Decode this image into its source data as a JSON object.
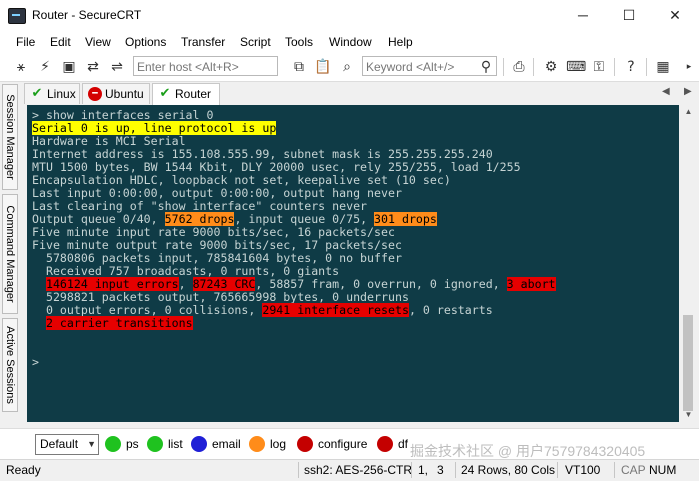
{
  "window": {
    "title": "Router - SecureCRT",
    "controls": [
      "─",
      "☐",
      "✕"
    ]
  },
  "menu": [
    "File",
    "Edit",
    "View",
    "Options",
    "Transfer",
    "Script",
    "Tools",
    "Window",
    "Help"
  ],
  "toolbar": {
    "host_placeholder": "Enter host <Alt+R>",
    "keyword_placeholder": "Keyword <Alt+/>"
  },
  "side_tabs": [
    "Session Manager",
    "Command Manager",
    "Active Sessions"
  ],
  "session_tabs": [
    {
      "label": "Linux",
      "icon": "check-icon",
      "color": "#1a9e1a"
    },
    {
      "label": "Ubuntu",
      "icon": "stop-icon",
      "color": "#d40000"
    },
    {
      "label": "Router",
      "icon": "check-icon",
      "color": "#1a9e1a"
    }
  ],
  "terminal": {
    "lines": [
      [
        {
          "t": "> show interfaces serial 0",
          "hl": ""
        }
      ],
      [
        {
          "t": "Serial 0 is up, line protocol is up",
          "hl": "yellow"
        }
      ],
      [
        {
          "t": "Hardware is MCI Serial",
          "hl": ""
        }
      ],
      [
        {
          "t": "Internet address is 155.108.555.99, subnet mask is 255.255.255.240",
          "hl": ""
        }
      ],
      [
        {
          "t": "MTU 1500 bytes, BW 1544 Kbit, DLY 20000 usec, rely 255/255, load 1/255",
          "hl": ""
        }
      ],
      [
        {
          "t": "Encapsulation HDLC, loopback not set, keepalive set (10 sec)",
          "hl": ""
        }
      ],
      [
        {
          "t": "Last input 0:00:00, output 0:00:00, output hang never",
          "hl": ""
        }
      ],
      [
        {
          "t": "Last clearing of \"show interface\" counters never",
          "hl": ""
        }
      ],
      [
        {
          "t": "Output queue 0/40, ",
          "hl": ""
        },
        {
          "t": "5762 drops",
          "hl": "orange"
        },
        {
          "t": ", input queue 0/75, ",
          "hl": ""
        },
        {
          "t": "301 drops",
          "hl": "orange"
        }
      ],
      [
        {
          "t": "Five minute input rate 9000 bits/sec, 16 packets/sec",
          "hl": ""
        }
      ],
      [
        {
          "t": "Five minute output rate 9000 bits/sec, 17 packets/sec",
          "hl": ""
        }
      ],
      [
        {
          "t": "  5780806 packets input, 785841604 bytes, 0 no buffer",
          "hl": ""
        }
      ],
      [
        {
          "t": "  Received 757 broadcasts, 0 runts, 0 giants",
          "hl": ""
        }
      ],
      [
        {
          "t": "  ",
          "hl": ""
        },
        {
          "t": "146124 input errors",
          "hl": "red"
        },
        {
          "t": ", ",
          "hl": ""
        },
        {
          "t": "87243 CRC",
          "hl": "red"
        },
        {
          "t": ", 58857 fram, 0 overrun, 0 ignored, ",
          "hl": ""
        },
        {
          "t": "3 abort",
          "hl": "red"
        }
      ],
      [
        {
          "t": "  5298821 packets output, 765665998 bytes, 0 underruns",
          "hl": ""
        }
      ],
      [
        {
          "t": "  0 output errors, 0 collisions, ",
          "hl": ""
        },
        {
          "t": "2941 interface resets",
          "hl": "red"
        },
        {
          "t": ", 0 restarts",
          "hl": ""
        }
      ],
      [
        {
          "t": "  ",
          "hl": ""
        },
        {
          "t": "2 carrier transitions",
          "hl": "red"
        }
      ],
      [
        {
          "t": "",
          "hl": ""
        }
      ],
      [
        {
          "t": "",
          "hl": ""
        }
      ],
      [
        {
          "t": ">",
          "hl": ""
        }
      ]
    ]
  },
  "button_bar": {
    "selected": "Default",
    "buttons": [
      {
        "label": "ps",
        "color": "#1fc21f"
      },
      {
        "label": "list",
        "color": "#1fc21f"
      },
      {
        "label": "email",
        "color": "#1f1fd6"
      },
      {
        "label": "log",
        "color": "#ff8c1a"
      },
      {
        "label": "configure",
        "color": "#c40000"
      },
      {
        "label": "df",
        "color": "#c40000"
      }
    ]
  },
  "watermark": "掘金技术社区 @ 用户7579784320405",
  "status": {
    "ready": "Ready",
    "cipher": "ssh2: AES-256-CTR",
    "row": "1,",
    "col": "3",
    "size": "24 Rows, 80 Cols",
    "term": "VT100",
    "cap": "CAP",
    "num": "NUM"
  }
}
